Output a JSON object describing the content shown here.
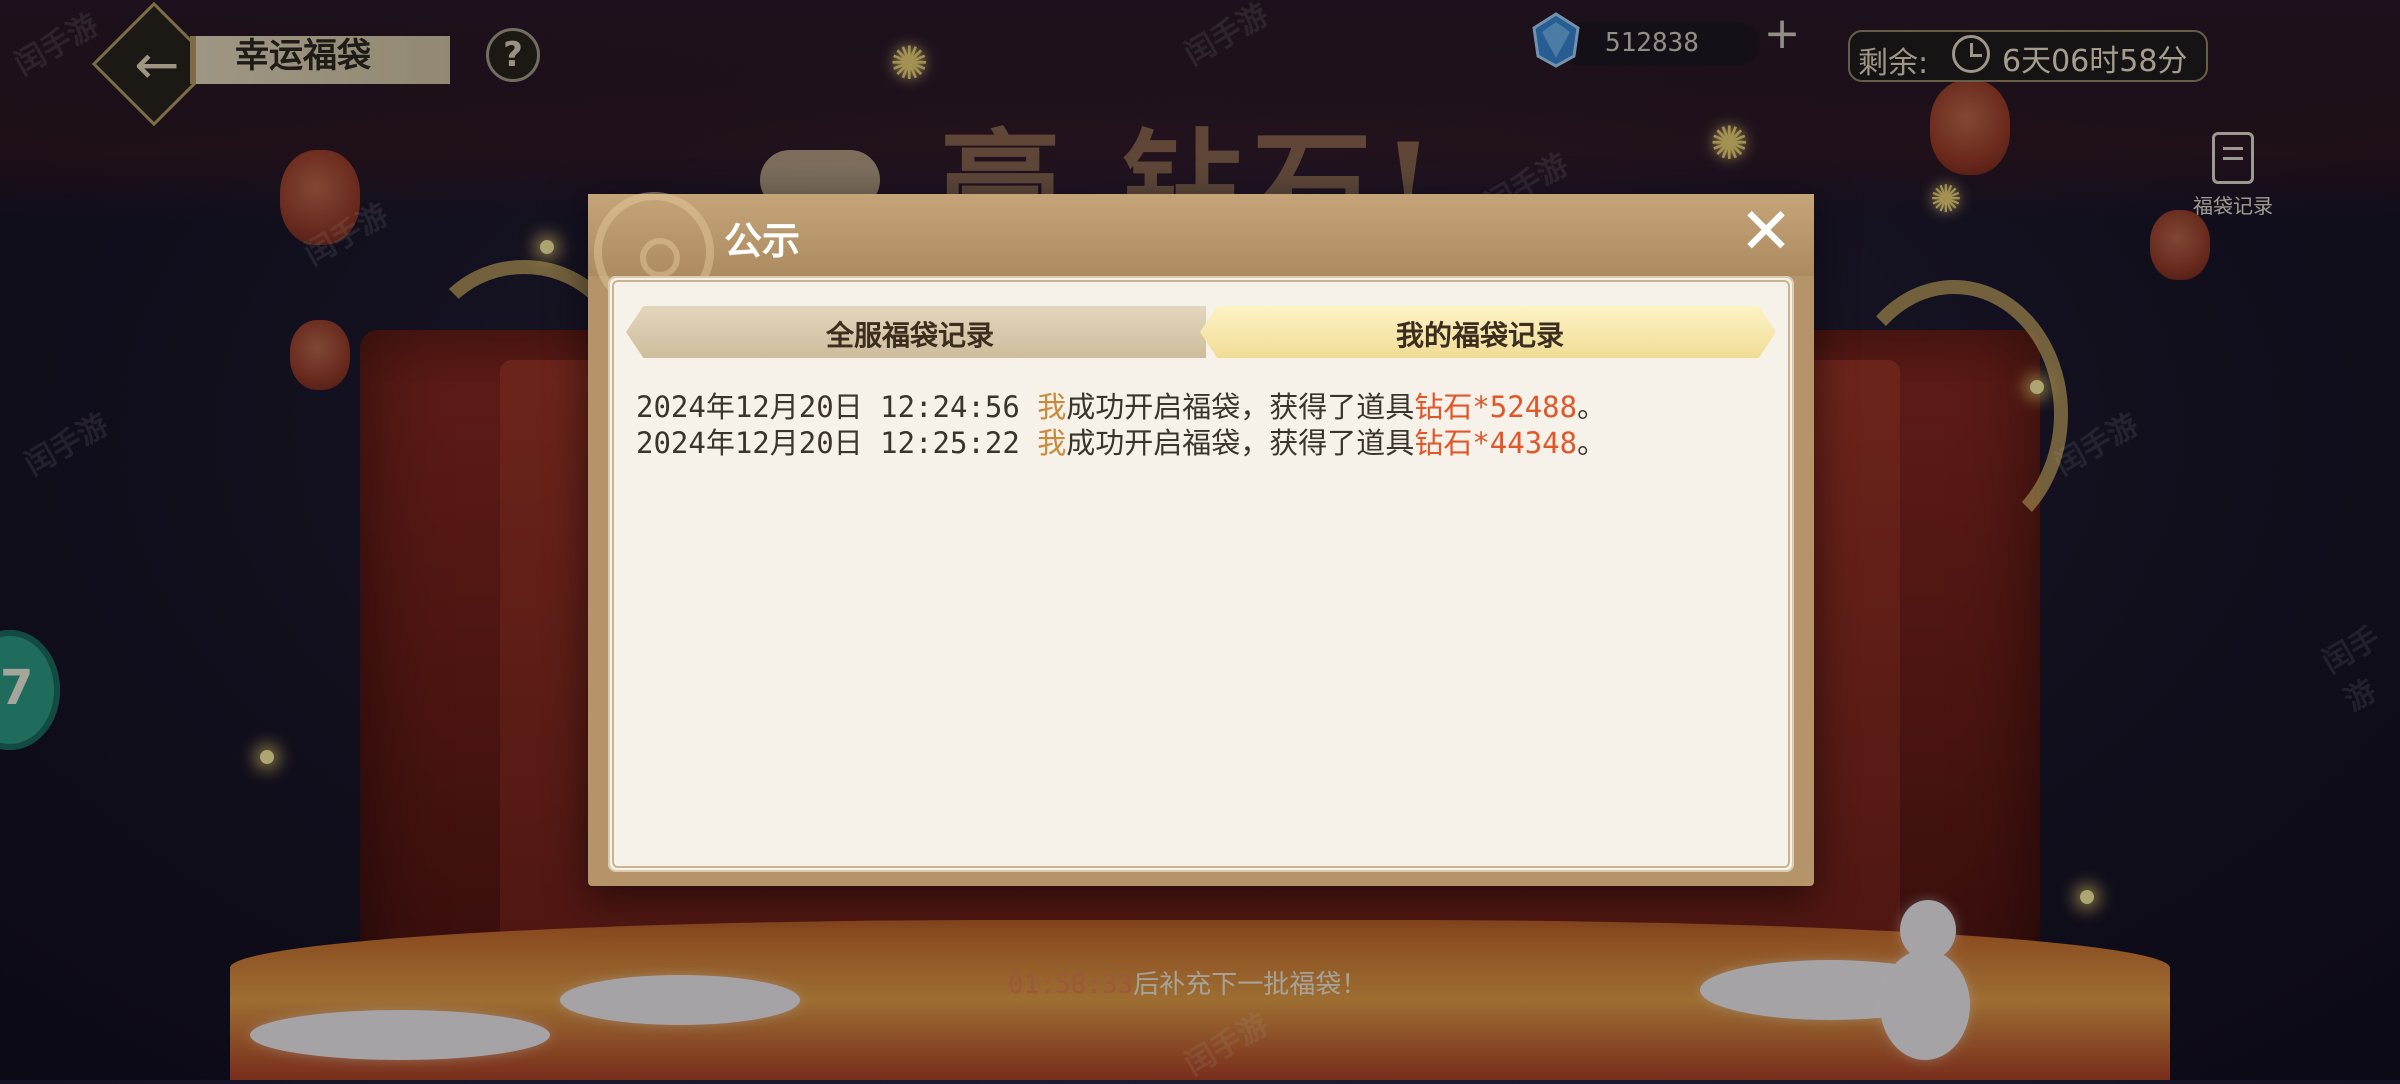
{
  "header": {
    "title": "幸运福袋",
    "help_label": "?"
  },
  "currency": {
    "value": "512838",
    "plus_label": "+"
  },
  "timer": {
    "label": "剩余:",
    "value": "6天06时58分"
  },
  "side_menu": {
    "bag_record_label": "福袋记录"
  },
  "side_chip": {
    "label": "7"
  },
  "refill": {
    "time": "01:58:33",
    "suffix": "后补充下一批福袋！"
  },
  "dialog": {
    "title": "公示",
    "close_label": "✕",
    "tabs": [
      {
        "label": "全服福袋记录",
        "active": false
      },
      {
        "label": "我的福袋记录",
        "active": true
      }
    ],
    "records": [
      {
        "datetime": "2024年12月20日 12:24:56",
        "actor": "我",
        "action": "成功开启福袋，获得了道具",
        "item": "钻石*52488",
        "end": "。"
      },
      {
        "datetime": "2024年12月20日 12:25:22",
        "actor": "我",
        "action": "成功开启福袋，获得了道具",
        "item": "钻石*44348",
        "end": "。"
      }
    ]
  },
  "colors": {
    "accent_gold": "#b49468",
    "highlight_me": "#c88a3c",
    "highlight_item": "#e0572a",
    "panel_bg": "#f7f2e9"
  },
  "icons": [
    "back-arrow-icon",
    "help-icon",
    "diamond-gem-icon",
    "plus-icon",
    "clock-icon",
    "bag-record-icon",
    "close-icon",
    "wheel-decoration-icon"
  ]
}
